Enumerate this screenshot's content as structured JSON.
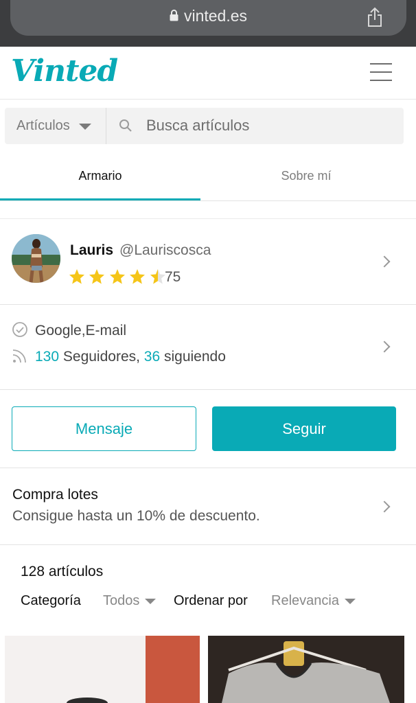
{
  "browser": {
    "url": "vinted.es"
  },
  "header": {
    "logo": "Vinted"
  },
  "search": {
    "category": "Artículos",
    "placeholder": "Busca artículos"
  },
  "tabs": [
    {
      "label": "Armario",
      "active": true
    },
    {
      "label": "Sobre mí",
      "active": false
    }
  ],
  "profile": {
    "name": "Lauris",
    "handle": "@Lauriscosca",
    "rating_stars": 4.5,
    "rating_count": "75"
  },
  "verification": {
    "methods": "Google,E-mail",
    "followers_count": "130",
    "followers_label": " Seguidores, ",
    "following_count": "36",
    "following_label": " siguiendo"
  },
  "actions": {
    "message_label": "Mensaje",
    "follow_label": "Seguir"
  },
  "bundles": {
    "title": "Compra lotes",
    "subtitle": "Consigue hasta un 10% de descuento."
  },
  "items": {
    "count_label": "128 artículos",
    "category_label": "Categoría",
    "category_value": "Todos",
    "sort_label": "Ordenar por",
    "sort_value": "Relevancia"
  },
  "colors": {
    "accent": "#09aab6",
    "star": "#f5c518"
  }
}
